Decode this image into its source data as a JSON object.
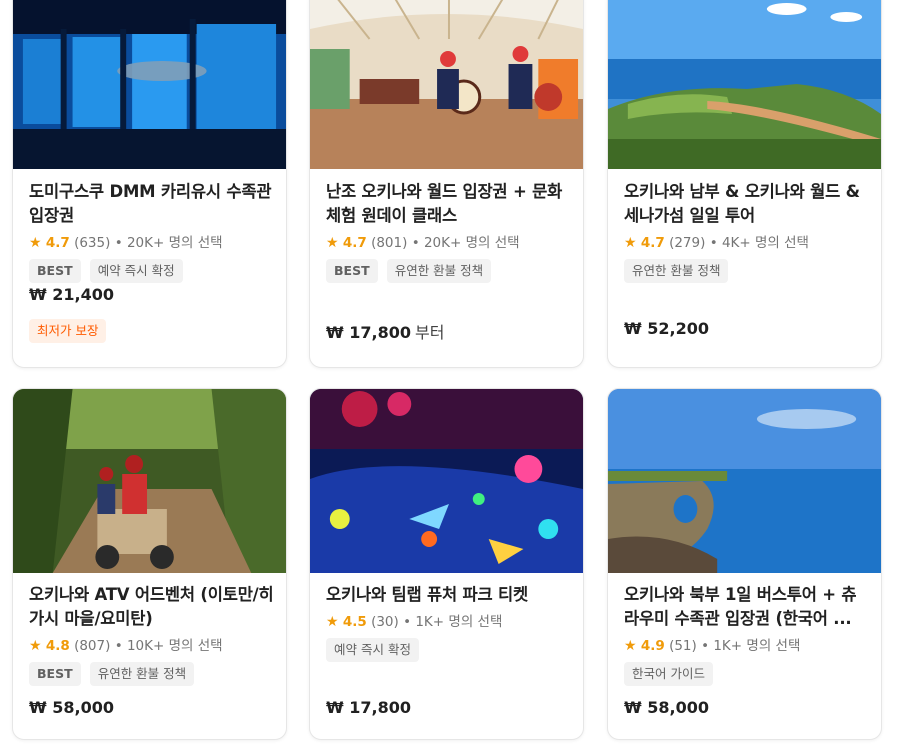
{
  "colors": {
    "star": "#f09b0a",
    "promo_text": "#ff5b00",
    "promo_bg": "#fff0e6",
    "tag_bg": "#f2f2f2"
  },
  "cards": [
    {
      "image": "aquarium-whale-shark-tunnel",
      "title": "도미구스쿠 DMM 카리유시 수족관 입장권",
      "rating": "4.7",
      "reviews": "(635)",
      "popularity": "• 20K+ 명의 선택",
      "tags": [
        "BEST",
        "예약 즉시 확정"
      ],
      "price": "₩ 21,400",
      "price_suffix": "",
      "promo": "최저가 보장"
    },
    {
      "image": "eisa-drum-dancers",
      "title": "난조 오키나와 월드 입장권 + 문화체험 원데이 클래스",
      "rating": "4.7",
      "reviews": "(801)",
      "popularity": "• 20K+ 명의 선택",
      "tags": [
        "BEST",
        "유연한 환불 정책"
      ],
      "price": "₩ 17,800",
      "price_suffix": "부터"
    },
    {
      "image": "seaside-cliff-point",
      "title": "오키나와 남부 & 오키나와 월드 & 세나가섬 일일 투어",
      "rating": "4.7",
      "reviews": "(279)",
      "popularity": "• 4K+ 명의 선택",
      "tags": [
        "유연한 환불 정책"
      ],
      "price": "₩ 52,200",
      "price_suffix": ""
    },
    {
      "image": "atv-jungle-ride",
      "title": "오키나와 ATV 어드벤처 (이토만/히가시 마을/요미탄)",
      "rating": "4.8",
      "reviews": "(807)",
      "popularity": "• 10K+ 명의 선택",
      "tags": [
        "BEST",
        "유연한 환불 정책"
      ],
      "price": "₩ 58,000",
      "price_suffix": ""
    },
    {
      "image": "teamlab-digital-art",
      "title": "오키나와 팀랩 퓨처 파크 티켓",
      "rating": "4.5",
      "reviews": "(30)",
      "popularity": "• 1K+ 명의 선택",
      "tags": [
        "예약 즉시 확정"
      ],
      "price": "₩ 17,800",
      "price_suffix": ""
    },
    {
      "image": "northern-sea-rock-arch",
      "title": "오키나와 북부 1일 버스투어 + 츄라우미 수족관 입장권 (한국어 ...",
      "rating": "4.9",
      "reviews": "(51)",
      "popularity": "• 1K+ 명의 선택",
      "tags": [
        "한국어 가이드"
      ],
      "price": "₩ 58,000",
      "price_suffix": ""
    }
  ]
}
